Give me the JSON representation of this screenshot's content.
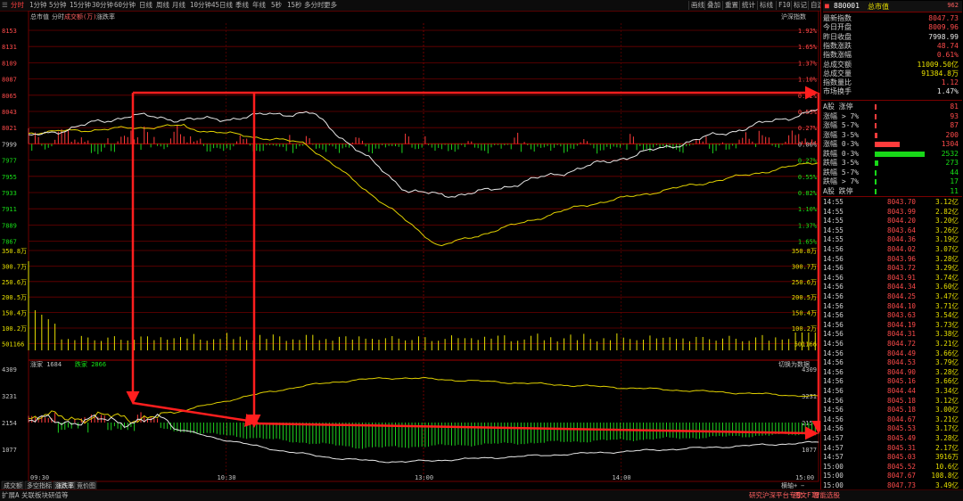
{
  "toolbar": {
    "items": [
      "分时",
      "1分钟",
      "5分钟",
      "15分钟",
      "30分钟",
      "60分钟",
      "日线",
      "周线",
      "月线",
      "10分钟",
      "45日线",
      "季线",
      "年线",
      "5秒",
      "15秒",
      "多分时",
      "更多"
    ],
    "right_items": [
      "画线",
      "叠加",
      "重置",
      "统计",
      "标线",
      "F10",
      "标记",
      "自选",
      "返回"
    ]
  },
  "chart_header": {
    "left": [
      "总市值",
      "分时",
      "成交额(万)",
      "涨跌率"
    ],
    "right": "沪深指数"
  },
  "price_axis": {
    "left": [
      "8153",
      "8131",
      "8109",
      "8087",
      "8065",
      "8043",
      "8021",
      "7999",
      "7977",
      "7955",
      "7933",
      "7911",
      "7889",
      "7867"
    ],
    "right": [
      "1.92%",
      "1.65%",
      "1.37%",
      "1.10%",
      "0.82%",
      "0.55%",
      "0.27%",
      "0.00%",
      "0.27%",
      "0.55%",
      "0.82%",
      "1.10%",
      "1.37%",
      "1.65%"
    ]
  },
  "volume_axis": {
    "labels": [
      "350.8万",
      "300.7万",
      "250.6万",
      "200.5万",
      "150.4万",
      "100.2万",
      "501166"
    ]
  },
  "indicator": {
    "label1": "涨家 1684",
    "label2": "跌家 2866",
    "right_label": "切换为数据",
    "axis": [
      "4309",
      "3231",
      "2154",
      "1077"
    ]
  },
  "time_axis": [
    "09:30",
    "10:30",
    "13:00",
    "14:00",
    "15:00"
  ],
  "bottom_tabs": [
    "成交额",
    "多空指标",
    "涨跌率",
    "竞价图"
  ],
  "bottom_tabs2": [
    "扩展A",
    "关联板块",
    "研值等"
  ],
  "bottom_right": [
    "研究沪深平台专享",
    "图文F10",
    "智能选股"
  ],
  "bottom_ctrl": [
    "横轴",
    "+",
    "−"
  ],
  "panel": {
    "code": "880001",
    "name": "总市值",
    "badge": "962",
    "stats": [
      {
        "label": "最新指数",
        "value": "8047.73",
        "color": "red"
      },
      {
        "label": "今日开盘",
        "value": "8009.96",
        "color": "red"
      },
      {
        "label": "昨日收盘",
        "value": "7998.99",
        "color": "white"
      },
      {
        "label": "指数涨跌",
        "value": "48.74",
        "color": "red"
      },
      {
        "label": "指数涨幅",
        "value": "0.61%",
        "color": "red"
      },
      {
        "label": "总成交额",
        "value": "11009.50亿",
        "color": "yel"
      },
      {
        "label": "总成交量",
        "value": "91384.8万",
        "color": "yel"
      },
      {
        "label": "指数量比",
        "value": "1.12",
        "color": "red"
      },
      {
        "label": "市场换手",
        "value": "1.47%",
        "color": "white"
      }
    ],
    "dist": [
      {
        "label": "A股 涨停",
        "value": "81",
        "color": "red",
        "bar": 0.01
      },
      {
        "label": "涨幅 > 7%",
        "value": "93",
        "color": "red",
        "bar": 0.01
      },
      {
        "label": "涨幅 5-7%",
        "value": "87",
        "color": "red",
        "bar": 0.01
      },
      {
        "label": "涨幅 3-5%",
        "value": "200",
        "color": "red",
        "bar": 0.05
      },
      {
        "label": "涨幅 0-3%",
        "value": "1304",
        "color": "red",
        "bar": 0.45
      },
      {
        "label": "跌幅 0-3%",
        "value": "2532",
        "color": "green",
        "bar": 0.9
      },
      {
        "label": "跌幅 3-5%",
        "value": "273",
        "color": "green",
        "bar": 0.06
      },
      {
        "label": "跌幅 5-7%",
        "value": "44",
        "color": "green",
        "bar": 0.01
      },
      {
        "label": "跌幅 > 7%",
        "value": "17",
        "color": "green",
        "bar": 0.01
      },
      {
        "label": "A股 跌停",
        "value": "11",
        "color": "green",
        "bar": 0.01
      }
    ],
    "ticks": [
      {
        "t": "14:55",
        "p": "8043.70",
        "v": "3.12亿"
      },
      {
        "t": "14:55",
        "p": "8043.99",
        "v": "2.82亿"
      },
      {
        "t": "14:55",
        "p": "8044.20",
        "v": "3.20亿"
      },
      {
        "t": "14:55",
        "p": "8043.64",
        "v": "3.26亿"
      },
      {
        "t": "14:55",
        "p": "8044.36",
        "v": "3.19亿"
      },
      {
        "t": "14:56",
        "p": "8044.02",
        "v": "3.07亿"
      },
      {
        "t": "14:56",
        "p": "8043.96",
        "v": "3.28亿"
      },
      {
        "t": "14:56",
        "p": "8043.72",
        "v": "3.29亿"
      },
      {
        "t": "14:56",
        "p": "8043.91",
        "v": "3.74亿"
      },
      {
        "t": "14:56",
        "p": "8044.34",
        "v": "3.60亿"
      },
      {
        "t": "14:56",
        "p": "8044.25",
        "v": "3.47亿"
      },
      {
        "t": "14:56",
        "p": "8044.10",
        "v": "3.71亿"
      },
      {
        "t": "14:56",
        "p": "8043.63",
        "v": "3.54亿"
      },
      {
        "t": "14:56",
        "p": "8044.19",
        "v": "3.73亿"
      },
      {
        "t": "14:56",
        "p": "8044.31",
        "v": "3.38亿"
      },
      {
        "t": "14:56",
        "p": "8044.72",
        "v": "3.21亿"
      },
      {
        "t": "14:56",
        "p": "8044.49",
        "v": "3.66亿"
      },
      {
        "t": "14:56",
        "p": "8044.53",
        "v": "3.79亿"
      },
      {
        "t": "14:56",
        "p": "8044.90",
        "v": "3.28亿"
      },
      {
        "t": "14:56",
        "p": "8045.16",
        "v": "3.66亿"
      },
      {
        "t": "14:56",
        "p": "8044.44",
        "v": "3.34亿"
      },
      {
        "t": "14:56",
        "p": "8045.18",
        "v": "3.12亿"
      },
      {
        "t": "14:56",
        "p": "8045.18",
        "v": "3.00亿"
      },
      {
        "t": "14:56",
        "p": "8044.67",
        "v": "3.21亿"
      },
      {
        "t": "14:56",
        "p": "8045.53",
        "v": "3.17亿"
      },
      {
        "t": "14:57",
        "p": "8045.49",
        "v": "3.28亿"
      },
      {
        "t": "14:57",
        "p": "8045.31",
        "v": "2.17亿"
      },
      {
        "t": "14:57",
        "p": "8045.03",
        "v": "3916万"
      },
      {
        "t": "15:00",
        "p": "8045.52",
        "v": "10.6亿"
      },
      {
        "t": "15:00",
        "p": "8047.67",
        "v": "108.8亿"
      },
      {
        "t": "15:00",
        "p": "8047.73",
        "v": "3.49亿"
      }
    ]
  },
  "colors": {
    "up": "#ff3c3c",
    "down": "#1ed21e",
    "grid": "#6e0000",
    "index": "#e8e8e8",
    "avg": "#e0d000",
    "arrow": "#ff1e1e"
  }
}
